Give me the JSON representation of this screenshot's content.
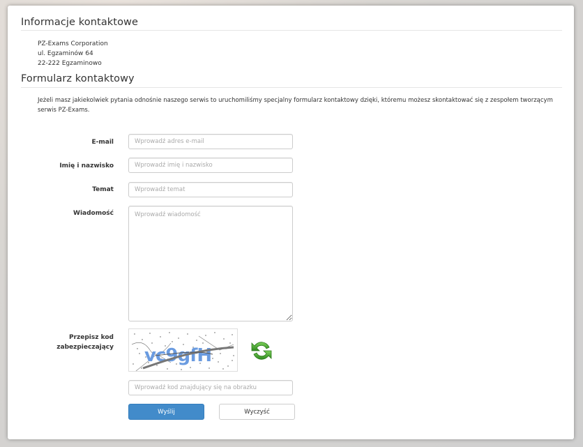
{
  "contact_info": {
    "title": "Informacje kontaktowe",
    "address_lines": [
      "PZ-Exams Corporation",
      "ul. Egzaminów 64",
      "22-222 Egzaminowo"
    ]
  },
  "contact_form": {
    "title": "Formularz kontaktowy",
    "intro": "Jeżeli masz jakiekolwiek pytania odnośnie naszego serwis to uruchomiliśmy specjalny formularz kontaktowy dzięki, któremu możesz skontaktować się z zespołem tworzącym serwis PZ-Exams.",
    "email": {
      "label": "E-mail",
      "placeholder": "Wprowadź adres e-mail",
      "value": ""
    },
    "name": {
      "label": "Imię i nazwisko",
      "placeholder": "Wprowadź imię i nazwisko",
      "value": ""
    },
    "subject": {
      "label": "Temat",
      "placeholder": "Wprowadź temat",
      "value": ""
    },
    "message": {
      "label": "Wiadomość",
      "placeholder": "Wprowadź wiadomość",
      "value": ""
    },
    "captcha": {
      "label_line1": "Przepisz kod",
      "label_line2": "zabezpieczający",
      "image_text": "vc9gfH",
      "input_placeholder": "Wprowadź kod znajdujący się na obrazku"
    },
    "buttons": {
      "submit": "Wyślij",
      "clear": "Wyczyść"
    }
  },
  "colors": {
    "primary": "#428bca",
    "refresh_icon": "#3a9a2a",
    "captcha_text": "#6a9be0"
  },
  "icons": {
    "refresh": "refresh-icon"
  }
}
